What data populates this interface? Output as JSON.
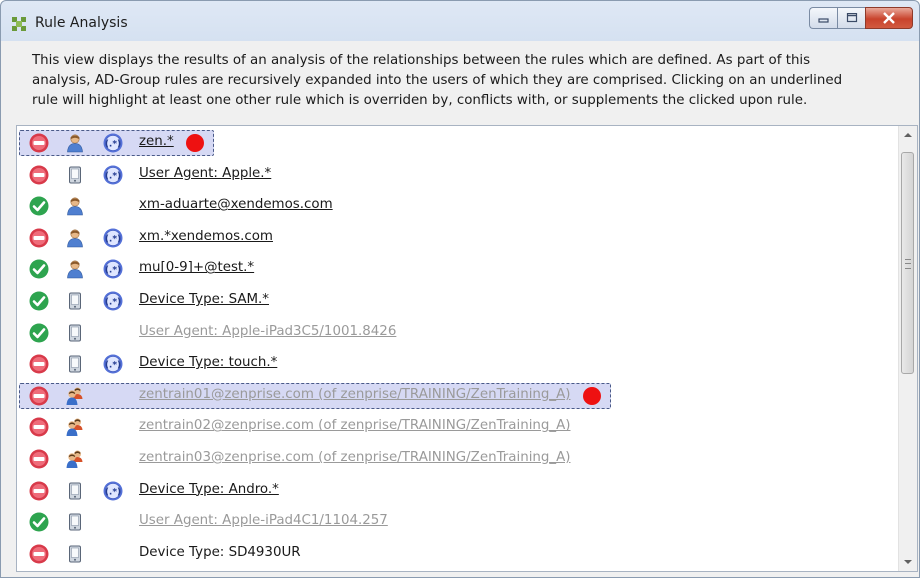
{
  "window": {
    "title": "Rule Analysis",
    "controls": {
      "minimize": "minimize",
      "maximize": "maximize",
      "close": "close"
    }
  },
  "description": "This view displays the results of an analysis of the relationships between the rules which are defined. As part of this analysis, AD-Group rules are recursively expanded into the users of which they are comprised. Clicking on an underlined rule will highlight at least one other rule which is overriden by, conflicts with, or supplements the clicked upon rule.",
  "colors": {
    "marker": "#ee1111",
    "selection": "#b4b9eb",
    "allow": "#2ea44f",
    "deny": "#d83a4a"
  },
  "rules": [
    {
      "status": "deny",
      "kind": "user",
      "regex": true,
      "label": "zen.*",
      "underline": true,
      "dim": false,
      "selected": true,
      "marker": true
    },
    {
      "status": "deny",
      "kind": "device",
      "regex": true,
      "label": "User Agent: Apple.*",
      "underline": true,
      "dim": false
    },
    {
      "status": "allow",
      "kind": "user",
      "regex": false,
      "label": "xm-aduarte@xendemos.com",
      "underline": true,
      "dim": false
    },
    {
      "status": "deny",
      "kind": "user",
      "regex": true,
      "label": "xm.*xendemos.com",
      "underline": true,
      "dim": false
    },
    {
      "status": "allow",
      "kind": "user",
      "regex": true,
      "label": "mu[0-9]+@test.*",
      "underline": true,
      "dim": false
    },
    {
      "status": "allow",
      "kind": "device",
      "regex": true,
      "label": "Device Type: SAM.*",
      "underline": true,
      "dim": false
    },
    {
      "status": "allow",
      "kind": "device",
      "regex": false,
      "label": "User Agent: Apple-iPad3C5/1001.8426",
      "underline": true,
      "dim": true
    },
    {
      "status": "deny",
      "kind": "device",
      "regex": true,
      "label": "Device Type: touch.*",
      "underline": true,
      "dim": false
    },
    {
      "status": "deny",
      "kind": "group",
      "regex": false,
      "label": "zentrain01@zenprise.com (of zenprise/TRAINING/ZenTraining_A)",
      "underline": true,
      "dim": true,
      "selected": true,
      "marker": true
    },
    {
      "status": "deny",
      "kind": "group",
      "regex": false,
      "label": "zentrain02@zenprise.com (of zenprise/TRAINING/ZenTraining_A)",
      "underline": true,
      "dim": true
    },
    {
      "status": "deny",
      "kind": "group",
      "regex": false,
      "label": "zentrain03@zenprise.com (of zenprise/TRAINING/ZenTraining_A)",
      "underline": true,
      "dim": true
    },
    {
      "status": "deny",
      "kind": "device",
      "regex": true,
      "label": "Device Type: Andro.*",
      "underline": true,
      "dim": false
    },
    {
      "status": "allow",
      "kind": "device",
      "regex": false,
      "label": "User Agent: Apple-iPad4C1/1104.257",
      "underline": true,
      "dim": true
    },
    {
      "status": "deny",
      "kind": "device",
      "regex": false,
      "label": "Device Type: SD4930UR",
      "underline": false,
      "dim": false
    }
  ]
}
